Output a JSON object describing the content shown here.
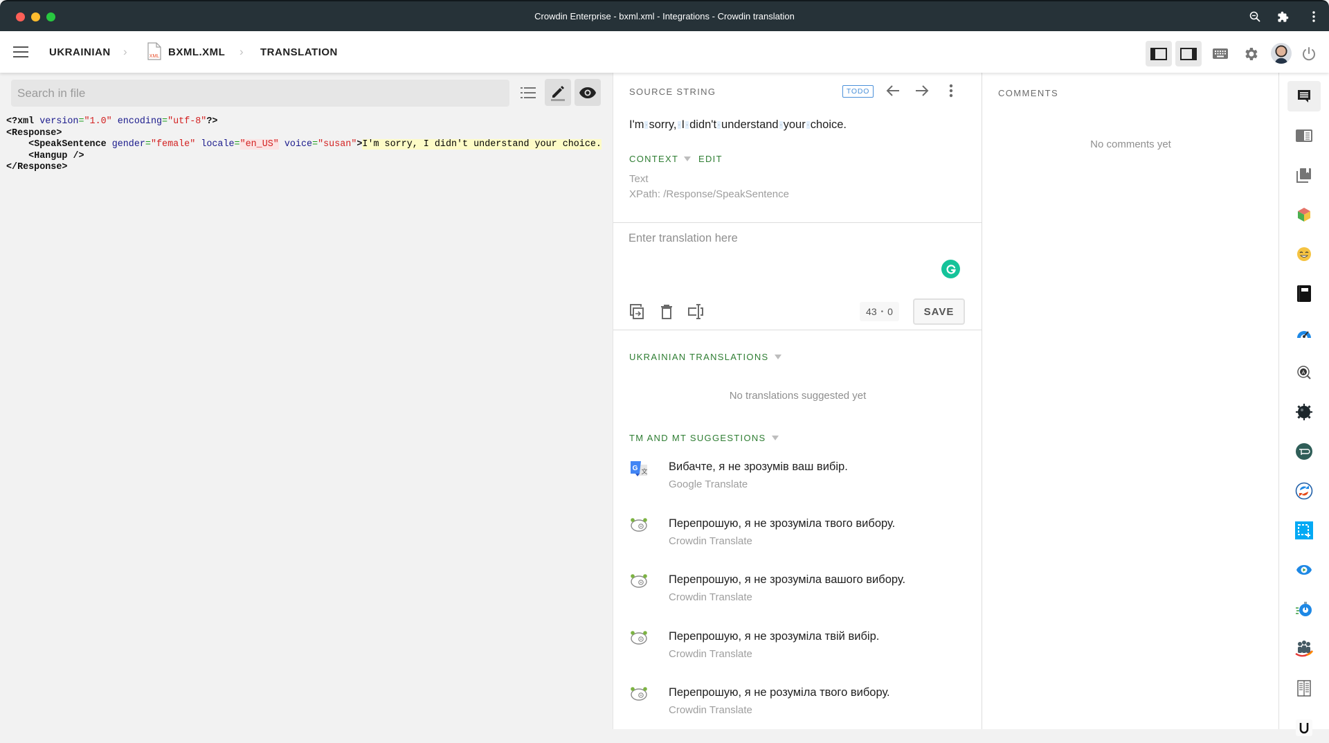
{
  "window": {
    "title": "Crowdin Enterprise - bxml.xml - Integrations - Crowdin translation"
  },
  "header": {
    "breadcrumb": [
      {
        "label": "UKRAINIAN"
      },
      {
        "label": "BXML.XML",
        "icon": "xml-file-icon"
      },
      {
        "label": "TRANSLATION"
      }
    ],
    "file_icon_label": "XML",
    "right_buttons": [
      {
        "name": "toggle-left-panel",
        "icon": "left-panel-icon",
        "active": true
      },
      {
        "name": "toggle-right-panel",
        "icon": "right-panel-icon",
        "active": true
      },
      {
        "name": "keyboard-shortcuts",
        "icon": "keyboard-icon"
      },
      {
        "name": "settings",
        "icon": "gear-icon"
      },
      {
        "name": "user-avatar",
        "icon": "avatar"
      },
      {
        "name": "logout",
        "icon": "power-icon"
      }
    ]
  },
  "file_panel": {
    "search_placeholder": "Search in file",
    "search_value": "",
    "code_lines": [
      {
        "parts": [
          [
            "tag",
            "<?xml "
          ],
          [
            "attr",
            "version"
          ],
          [
            "eq",
            "="
          ],
          [
            "val",
            "\"1.0\""
          ],
          [
            "plain",
            " "
          ],
          [
            "attr",
            "encoding"
          ],
          [
            "eq",
            "="
          ],
          [
            "val",
            "\"utf-8\""
          ],
          [
            "tag",
            "?>"
          ]
        ]
      },
      {
        "parts": [
          [
            "tag",
            "<Response>"
          ]
        ]
      },
      {
        "parts": [
          [
            "plain",
            "    "
          ],
          [
            "tag",
            "<SpeakSentence "
          ],
          [
            "attr",
            "gender"
          ],
          [
            "eq",
            "="
          ],
          [
            "val",
            "\"female\""
          ],
          [
            "plain",
            " "
          ],
          [
            "attr",
            "locale"
          ],
          [
            "eq",
            "="
          ],
          [
            "valhl",
            "\"en_US\""
          ],
          [
            "plain",
            " "
          ],
          [
            "attr",
            "voice"
          ],
          [
            "eq",
            "="
          ],
          [
            "val",
            "\"susan\""
          ],
          [
            "tag",
            ">"
          ],
          [
            "texthl",
            "I'm sorry, I didn't understand your choice."
          ]
        ]
      },
      {
        "parts": [
          [
            "plain",
            "    "
          ],
          [
            "tag",
            "<Hangup />"
          ]
        ]
      },
      {
        "parts": [
          [
            "tag",
            "</Response>"
          ]
        ]
      }
    ]
  },
  "source": {
    "section_label": "SOURCE STRING",
    "status_badge": "TODO",
    "words": [
      "I'm",
      "sorry,",
      "I",
      "didn't",
      "understand",
      "your",
      "choice."
    ],
    "context_label": "CONTEXT",
    "edit_label": "EDIT",
    "context_type": "Text",
    "context_xpath": "XPath: /Response/SpeakSentence"
  },
  "editor": {
    "placeholder": "Enter translation here",
    "value": "",
    "source_length": "43",
    "translation_length": "0",
    "save_label": "SAVE"
  },
  "translations": {
    "section_label": "UKRAINIAN TRANSLATIONS",
    "empty_message": "No translations suggested yet"
  },
  "suggestions": {
    "section_label": "TM AND MT SUGGESTIONS",
    "items": [
      {
        "text": "Вибачте, я не зрозумів ваш вибір.",
        "source": "Google Translate",
        "icon": "google-translate-icon"
      },
      {
        "text": "Перепрошую, я не зрозуміла твого вибору.",
        "source": "Crowdin Translate",
        "icon": "crowdin-translate-icon"
      },
      {
        "text": "Перепрошую, я не зрозуміла вашого вибору.",
        "source": "Crowdin Translate",
        "icon": "crowdin-translate-icon"
      },
      {
        "text": "Перепрошую, я не зрозуміла твій вибір.",
        "source": "Crowdin Translate",
        "icon": "crowdin-translate-icon"
      },
      {
        "text": "Перепрошую, я не розуміла твого вибору.",
        "source": "Crowdin Translate",
        "icon": "crowdin-translate-icon"
      }
    ]
  },
  "comments": {
    "title": "COMMENTS",
    "empty_message": "No comments yet"
  },
  "right_rail": [
    {
      "name": "comments",
      "icon": "comment-icon",
      "active": true
    },
    {
      "name": "search-tm",
      "icon": "panel-list-icon"
    },
    {
      "name": "glossary",
      "icon": "bookmark-stack-icon"
    },
    {
      "name": "app-cube",
      "icon": "cube-icon"
    },
    {
      "name": "emoji-app",
      "icon": "smiley-icon"
    },
    {
      "name": "notebook-app",
      "icon": "notebook-icon"
    },
    {
      "name": "speed-app",
      "icon": "speedometer-icon"
    },
    {
      "name": "qa-app",
      "icon": "magnifier-a-icon"
    },
    {
      "name": "gear-app",
      "icon": "cog-dark-icon"
    },
    {
      "name": "p-app",
      "icon": "p-circle-icon"
    },
    {
      "name": "sync-app",
      "icon": "sync-arrows-icon"
    },
    {
      "name": "screenshot-app",
      "icon": "crop-select-icon"
    },
    {
      "name": "preview-app",
      "icon": "eye-play-icon"
    },
    {
      "name": "timer-app",
      "icon": "stopwatch-icon"
    },
    {
      "name": "team-app",
      "icon": "people-icon"
    },
    {
      "name": "book-app",
      "icon": "open-book-icon"
    },
    {
      "name": "u-app",
      "icon": "letter-u-icon"
    }
  ],
  "colors": {
    "titlebar": "#263238",
    "accent_green": "#2e7d32",
    "todo_blue": "#4a90d9",
    "grammarly": "#15c39a"
  }
}
